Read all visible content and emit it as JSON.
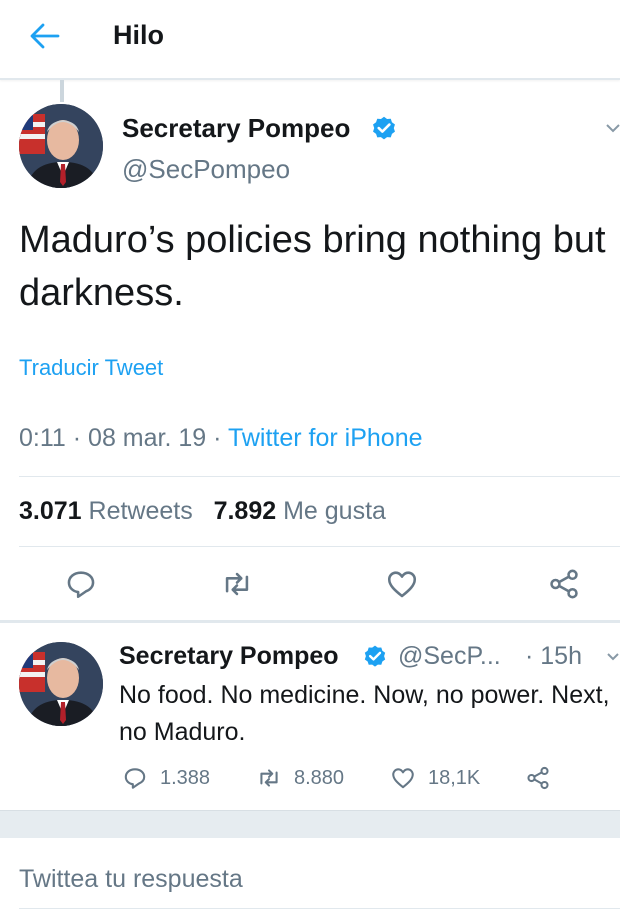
{
  "header": {
    "title": "Hilo",
    "back_icon": "arrow-left-icon"
  },
  "colors": {
    "accent": "#1da1f2",
    "text": "#14171a",
    "muted": "#657786",
    "border": "#e1e8ed",
    "like_red": "#e0245e"
  },
  "main_tweet": {
    "author_name": "Secretary Pompeo",
    "handle": "@SecPompeo",
    "verified": true,
    "text": "Maduro’s policies bring nothing but darkness.",
    "translate_label": "Traducir Tweet",
    "time": "0:11",
    "date": "08 mar. 19",
    "source": "Twitter for iPhone",
    "retweets_count": "3.071",
    "retweets_label": "Retweets",
    "likes_count": "7.892",
    "likes_label": "Me gusta",
    "actions": [
      "reply-icon",
      "retweet-icon",
      "like-icon",
      "share-icon"
    ]
  },
  "reply_tweet": {
    "author_name": "Secretary Pompeo",
    "handle": "@SecP...",
    "time_ago": "· 15h",
    "verified": true,
    "text": "No food. No medicine. Now, no power. Next, no Maduro.",
    "reply_count": "1.388",
    "retweet_count": "8.880",
    "like_count": "18,1K"
  },
  "compose": {
    "placeholder": "Twittea tu respuesta"
  }
}
